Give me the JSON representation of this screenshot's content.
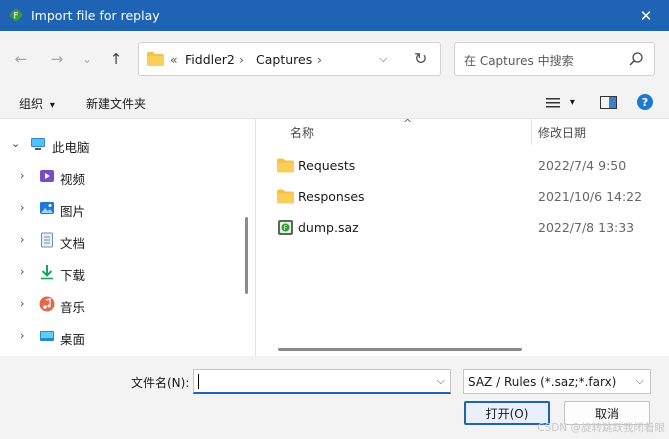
{
  "window": {
    "title": "Import file for replay",
    "close_glyph": "✕"
  },
  "navigation": {
    "back": "←",
    "forward": "→",
    "recent": "⌄",
    "up": "↑",
    "breadcrumb": {
      "overflow": "«",
      "segments": [
        "Fiddler2",
        "Captures"
      ],
      "separator": "›",
      "dropdown": "⌵",
      "refresh": "↻"
    },
    "search": {
      "placeholder": "在 Captures 中搜索"
    }
  },
  "toolbar": {
    "organize": "组织",
    "organize_arrow": "▾",
    "new_folder": "新建文件夹",
    "view_arrow": "▾",
    "help": "?"
  },
  "sidebar": {
    "items": [
      {
        "label": "此电脑",
        "icon": "pc-icon",
        "expanded": true
      },
      {
        "label": "视频",
        "icon": "video-icon"
      },
      {
        "label": "图片",
        "icon": "pictures-icon"
      },
      {
        "label": "文档",
        "icon": "documents-icon"
      },
      {
        "label": "下载",
        "icon": "downloads-icon"
      },
      {
        "label": "音乐",
        "icon": "music-icon"
      },
      {
        "label": "桌面",
        "icon": "desktop-icon"
      }
    ]
  },
  "files": {
    "columns": {
      "name": "名称",
      "modified": "修改日期"
    },
    "sort_arrow": "^",
    "rows": [
      {
        "name": "Requests",
        "type": "folder",
        "modified": "2022/7/4 9:50"
      },
      {
        "name": "Responses",
        "type": "folder",
        "modified": "2021/10/6 14:22"
      },
      {
        "name": "dump.saz",
        "type": "saz",
        "modified": "2022/7/8 13:33"
      }
    ]
  },
  "footer": {
    "filename_label": "文件名(N):",
    "filename_value": "",
    "filetype_value": "SAZ / Rules (*.saz;*.farx)",
    "dropdown": "⌵",
    "open_label": "打开(O)",
    "cancel_label": "取消"
  },
  "watermark": "CSDN @旋转跳跃我闭着眼",
  "colors": {
    "titlebar": "#1f64b4",
    "folder": "#f5c242",
    "accent": "#1f64b4",
    "fiddler_green": "#3a9a3a"
  }
}
